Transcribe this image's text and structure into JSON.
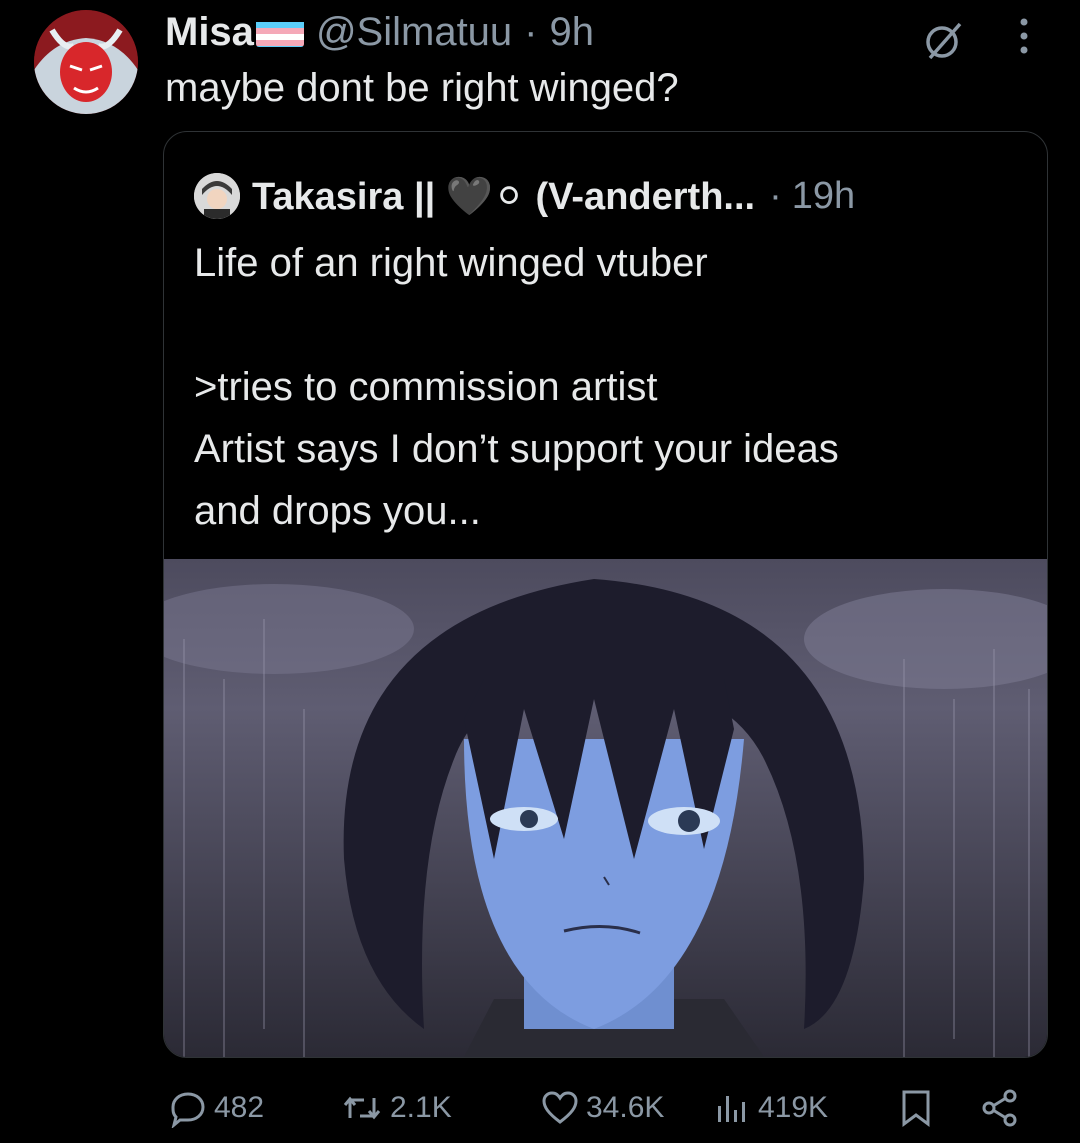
{
  "tweet": {
    "display_name": "Misa",
    "flag_icon": "transgender-flag-icon",
    "handle": "@Silmatuu",
    "separator": "·",
    "time": "9h",
    "text": "maybe dont be right winged?",
    "avatar_icon": "red-demon-avatar",
    "grok_icon": "grok-icon",
    "more_icon": "more-vertical-icon"
  },
  "quoted": {
    "display_name": "Takasira || 🖤⚪ (V-anderth...",
    "separator": "·",
    "time": "19h",
    "lines": [
      "Life of an right winged vtuber",
      "",
      ">tries to commission artist",
      "Artist says I don’t support your ideas",
      "and drops you..."
    ],
    "media_description_icon": "crying-anime-character-in-rain-image"
  },
  "actions": {
    "replies": "482",
    "reposts": "2.1K",
    "likes": "34.6K",
    "views": "419K",
    "reply_icon": "reply-icon",
    "repost_icon": "repost-icon",
    "like_icon": "heart-icon",
    "views_icon": "views-icon",
    "bookmark_icon": "bookmark-icon",
    "share_icon": "share-icon"
  },
  "colors": {
    "background": "#000000",
    "text": "#e7e9ea",
    "muted": "#8b98a5",
    "border": "#2f3336"
  }
}
